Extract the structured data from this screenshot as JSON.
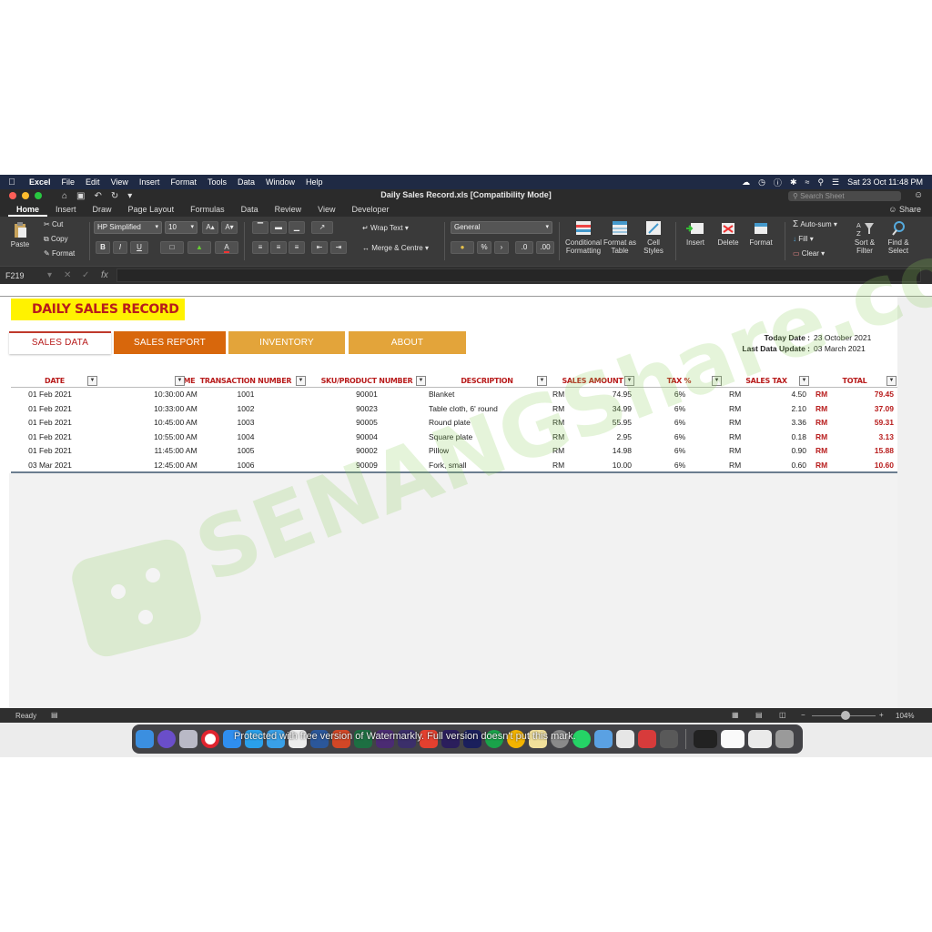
{
  "menubar": {
    "app": "Excel",
    "menus": [
      "File",
      "Edit",
      "View",
      "Insert",
      "Format",
      "Tools",
      "Data",
      "Window",
      "Help"
    ],
    "clock": "Sat 23 Oct  11:48 PM"
  },
  "window": {
    "title": "Daily Sales Record.xls  [Compatibility Mode]",
    "search_placeholder": "Search Sheet"
  },
  "ribbon_tabs": [
    "Home",
    "Insert",
    "Draw",
    "Page Layout",
    "Formulas",
    "Data",
    "Review",
    "View",
    "Developer"
  ],
  "share_label": "Share",
  "ribbon": {
    "paste": "Paste",
    "cut": "Cut",
    "copy": "Copy",
    "format_painter": "Format",
    "font_name": "HP Simplified",
    "font_size": "10",
    "wrap_text": "Wrap Text",
    "merge_centre": "Merge & Centre",
    "number_format": "General",
    "conditional_formatting": "Conditional Formatting",
    "format_as_table": "Format as Table",
    "cell_styles": "Cell Styles",
    "insert": "Insert",
    "delete": "Delete",
    "format": "Format",
    "auto_sum": "Auto-sum",
    "fill": "Fill",
    "clear": "Clear",
    "sort_filter": "Sort & Filter",
    "find_select": "Find & Select"
  },
  "formula_bar": {
    "cell_ref": "F219",
    "fx": "fx"
  },
  "sheet": {
    "title": "DAILY SALES RECORD",
    "nav": [
      "SALES DATA",
      "SALES REPORT",
      "INVENTORY",
      "ABOUT"
    ],
    "today_label": "Today Date :",
    "today_value": "23 October 2021",
    "last_update_label": "Last Data Update :",
    "last_update_value": "03 March 2021",
    "columns": [
      "DATE",
      "TIME",
      "TRANSACTION NUMBER",
      "SKU/PRODUCT NUMBER",
      "DESCRIPTION",
      "SALES AMOUNT",
      "TAX %",
      "SALES TAX",
      "TOTAL"
    ],
    "rows": [
      {
        "date": "01 Feb 2021",
        "time": "10:30:00 AM",
        "txn": "1001",
        "sku": "90001",
        "desc": "Blanket",
        "cur": "RM",
        "amount": "74.95",
        "tax_pct": "6%",
        "tax": "4.50",
        "total": "79.45"
      },
      {
        "date": "01 Feb 2021",
        "time": "10:33:00 AM",
        "txn": "1002",
        "sku": "90023",
        "desc": "Table cloth, 6' round",
        "cur": "RM",
        "amount": "34.99",
        "tax_pct": "6%",
        "tax": "2.10",
        "total": "37.09"
      },
      {
        "date": "01 Feb 2021",
        "time": "10:45:00 AM",
        "txn": "1003",
        "sku": "90005",
        "desc": "Round plate",
        "cur": "RM",
        "amount": "55.95",
        "tax_pct": "6%",
        "tax": "3.36",
        "total": "59.31"
      },
      {
        "date": "01 Feb 2021",
        "time": "10:55:00 AM",
        "txn": "1004",
        "sku": "90004",
        "desc": "Square plate",
        "cur": "RM",
        "amount": "2.95",
        "tax_pct": "6%",
        "tax": "0.18",
        "total": "3.13"
      },
      {
        "date": "01 Feb 2021",
        "time": "11:45:00 AM",
        "txn": "1005",
        "sku": "90002",
        "desc": "Pillow",
        "cur": "RM",
        "amount": "14.98",
        "tax_pct": "6%",
        "tax": "0.90",
        "total": "15.88"
      },
      {
        "date": "03 Mar 2021",
        "time": "12:45:00 AM",
        "txn": "1006",
        "sku": "90009",
        "desc": "Fork, small",
        "cur": "RM",
        "amount": "10.00",
        "tax_pct": "6%",
        "tax": "0.60",
        "total": "10.60"
      }
    ]
  },
  "watermark_text": "SENANGShare.com",
  "statusbar": {
    "ready": "Ready",
    "zoom": "104%"
  },
  "dock": {
    "notice": "Protected with free version of Watermarkly. Full version doesn't put this mark."
  },
  "colors": {
    "accent_red": "#b81c1c",
    "title_yellow": "#fff200",
    "tab_orange": "#d8670c",
    "tab_gold": "#e3a43a"
  }
}
